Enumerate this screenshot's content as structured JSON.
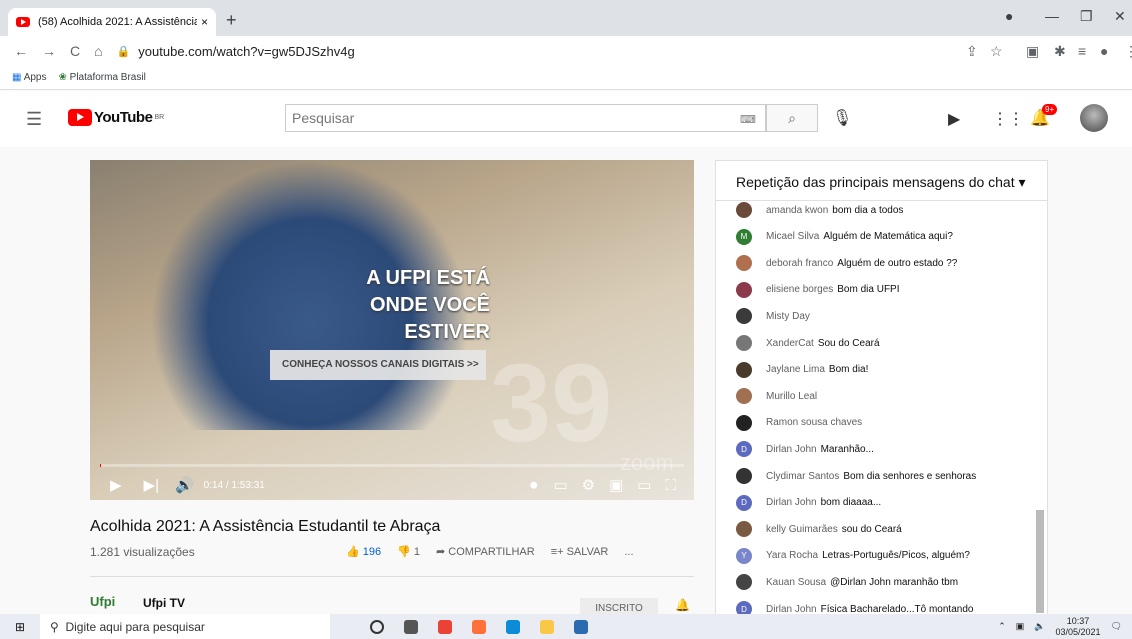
{
  "browser": {
    "tab_title": "(58) Acolhida 2021: A Assistência",
    "tab_close": "×",
    "new_tab": "+",
    "url": "youtube.com/watch?v=gw5DJSzhv4g",
    "bookmarks": [
      "Apps",
      "Plataforma Brasil"
    ]
  },
  "youtube": {
    "logo": "YouTube",
    "logo_region": "BR",
    "search_placeholder": "Pesquisar",
    "notification_badge": "9+"
  },
  "video": {
    "overlay_line1": "A UFPI ESTÁ",
    "overlay_line2": "ONDE VOCÊ",
    "overlay_line3": "ESTIVER",
    "overlay_cta": "CONHEÇA NOSSOS CANAIS DIGITAIS >>",
    "watermark_number": "39",
    "watermark_zoom": "zoom",
    "time": "0:14 / 1:53:31",
    "progress_fraction": 0.002,
    "title": "Acolhida 2021: A Assistência Estudantil te Abraça",
    "views": "1.281 visualizações",
    "likes": "196",
    "dislikes": "1",
    "share_label": "COMPARTILHAR",
    "save_label": "SALVAR",
    "more_label": "...",
    "channel_logo": "Ufpi",
    "channel_name": "Ufpi TV",
    "subscribed_label": "INSCRITO"
  },
  "chat": {
    "header": "Repetição das principais mensagens do chat",
    "messages": [
      {
        "author": "amanda kwon",
        "text": "bom dia a todos",
        "avatar": "",
        "color": "#6b4a3a"
      },
      {
        "author": "Micael Silva",
        "text": "Alguém de Matemática aqui?",
        "avatar": "M",
        "color": "#2e7d32"
      },
      {
        "author": "deborah franco",
        "text": "Alguém de outro estado ??",
        "avatar": "",
        "color": "#b07050"
      },
      {
        "author": "elisiene borges",
        "text": "Bom dia UFPI",
        "avatar": "",
        "color": "#8a3a4a"
      },
      {
        "author": "Misty Day",
        "text": "",
        "avatar": "",
        "color": "#3a3a3a"
      },
      {
        "author": "XanderCat",
        "text": "Sou do Ceará",
        "avatar": "",
        "color": "#777777"
      },
      {
        "author": "Jaylane Lima",
        "text": "Bom dia!",
        "avatar": "",
        "color": "#4a3a2a"
      },
      {
        "author": "Murillo Leal",
        "text": "",
        "avatar": "",
        "color": "#a07050"
      },
      {
        "author": "Ramon sousa chaves",
        "text": "",
        "avatar": "",
        "color": "#222222"
      },
      {
        "author": "Dirlan John",
        "text": "Maranhão...",
        "avatar": "D",
        "color": "#5c6bc0"
      },
      {
        "author": "Clydimar Santos",
        "text": "Bom dia senhores e senhoras",
        "avatar": "",
        "color": "#333333"
      },
      {
        "author": "Dirlan John",
        "text": "bom diaaaa...",
        "avatar": "D",
        "color": "#5c6bc0"
      },
      {
        "author": "kelly Guimarães",
        "text": "sou do Ceará",
        "avatar": "",
        "color": "#7a5a40"
      },
      {
        "author": "Yara Rocha",
        "text": "Letras-Português/Picos, alguém?",
        "avatar": "Y",
        "color": "#7986cb"
      },
      {
        "author": "Kauan Sousa",
        "text": "@Dirlan John maranhão tbm",
        "avatar": "",
        "color": "#444444"
      },
      {
        "author": "Dirlan John",
        "text": "Física Bacharelado...Tô montando",
        "avatar": "D",
        "color": "#5c6bc0"
      }
    ]
  },
  "taskbar": {
    "search": "Digite aqui para pesquisar",
    "time": "10:37",
    "date": "03/05/2021"
  },
  "colors": {
    "youtube_red": "#ff0000",
    "like_blue": "#065fd4"
  }
}
